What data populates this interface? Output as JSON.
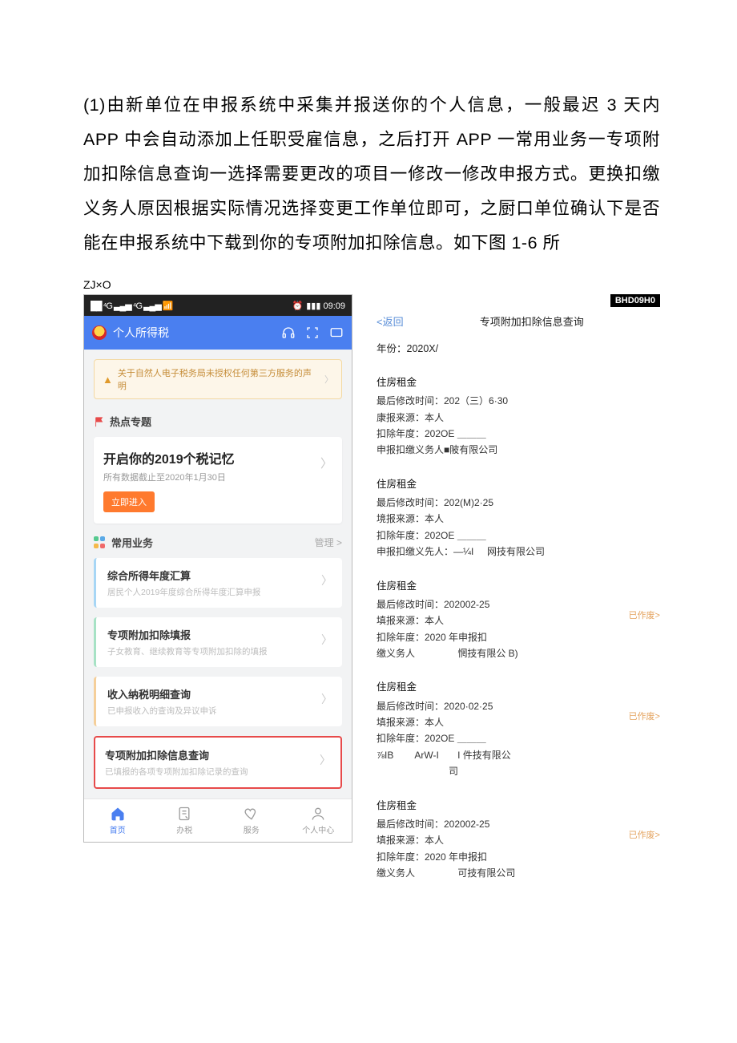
{
  "main_paragraph": "(1)由新单位在申报系统中采集并报送你的个人信息，一般最迟 3 天内 APP 中会自动添加上任职受雇信息，之后打开 APP 一常用业务一专项附加扣除信息查询一选择需要更改的项目一修改一修改申报方式。更换扣缴义务人原因根据实际情况选择变更工作单位即可，之厨口单位确认下是否能在申报系统中下载到你的专项附加扣除信息。如下图 1-6 所",
  "small_label": "ZJ×O",
  "phone": {
    "status_left": "██ ⁴G ▃▄▅ ⁴G ▃▄▅  📶",
    "status_right_alarm": "⏰",
    "status_right_time": "▮▮▮ 09:09",
    "app_title": "个人所得税",
    "notice": "关于自然人电子税务局未授权任何第三方服务的声明",
    "hot_section": "热点专题",
    "bigcard_title": "开启你的2019个税记忆",
    "bigcard_sub": "所有数据截止至2020年1月30日",
    "enter_btn": "立即进入",
    "common_section": "常用业务",
    "common_manage": "管理 >",
    "items": [
      {
        "title": "综合所得年度汇算",
        "sub": "居民个人2019年度综合所得年度汇算申报"
      },
      {
        "title": "专项附加扣除填报",
        "sub": "子女教育、继续教育等专项附加扣除的填报"
      },
      {
        "title": "收入纳税明细查询",
        "sub": "已申报收入的查询及异议申诉"
      },
      {
        "title": "专项附加扣除信息查询",
        "sub": "已填报的各项专项附加扣除记录的查询"
      }
    ],
    "tabs": [
      "首页",
      "办税",
      "服务",
      "个人中心"
    ]
  },
  "detail": {
    "badge": "BHD09H0",
    "back": "<返回",
    "title": "专项附加扣除信息查询",
    "year": "年份：2020X/",
    "blocks": [
      {
        "h": "住房租金",
        "lines": [
          "最后修改时间：202（三）6·30",
          "康报来源：本人",
          "扣除年度：202OE ＿＿＿",
          "申报扣缴义务人■陂有限公司"
        ],
        "tag": ""
      },
      {
        "h": "住房租金",
        "lines": [
          "最后修改时间：202(M)2·25",
          "境报来源：本人",
          "扣除年度：202OE ＿＿＿",
          "申报扣缴义先人：—¼I     网技有限公司"
        ],
        "tag": ""
      },
      {
        "h": "住房租金",
        "lines": [
          "最后修改时间：202002-25",
          "填报来源：本人",
          "扣除年度：2020 年申报扣",
          "缴义务人                惘技有限公 B)"
        ],
        "tag": "已作废>",
        "tag_line_index": 1
      },
      {
        "h": "住房租金",
        "lines": [
          "最后修改时间：2020·02·25",
          "填报来源：本人",
          "扣除年度：202OE ＿＿＿",
          "⅞IB        ArW-I       I 件技有限公\n                           司"
        ],
        "tag": "已作废>",
        "tag_line_index": 1
      },
      {
        "h": "住房租金",
        "lines": [
          "最后修改时间：202002-25",
          "填报来源：本人",
          "扣除年度：2020 年申报扣",
          "缴义务人                可技有限公司"
        ],
        "tag": "已作废>",
        "tag_line_index": 1
      }
    ]
  }
}
